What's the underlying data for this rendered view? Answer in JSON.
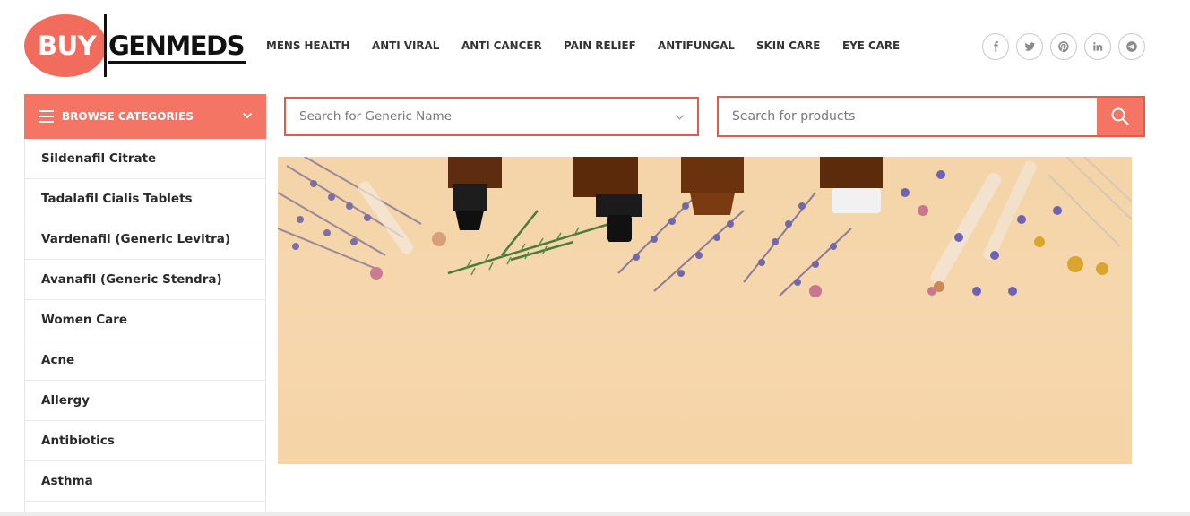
{
  "logo": {
    "part1": "BUY",
    "part2": "GENMEDS"
  },
  "nav": [
    "MENS HEALTH",
    "ANTI VIRAL",
    "ANTI CANCER",
    "PAIN RELIEF",
    "ANTIFUNGAL",
    "SKIN CARE",
    "EYE CARE"
  ],
  "social_icons": [
    "facebook-icon",
    "twitter-icon",
    "pinterest-icon",
    "linkedin-icon",
    "telegram-icon"
  ],
  "sidebar": {
    "header": "BROWSE CATEGORIES",
    "items": [
      "Sildenafil Citrate",
      "Tadalafil Cialis Tablets",
      "Vardenafil (Generic Levitra)",
      "Avanafil (Generic Stendra)",
      "Women Care",
      "Acne",
      "Allergy",
      "Antibiotics",
      "Asthma"
    ]
  },
  "search": {
    "generic_placeholder": "Search for Generic Name",
    "product_placeholder": "Search for products"
  },
  "colors": {
    "accent": "#f47563",
    "border_accent": "#e05c4d",
    "hero_bg": "#f5d4a7"
  }
}
